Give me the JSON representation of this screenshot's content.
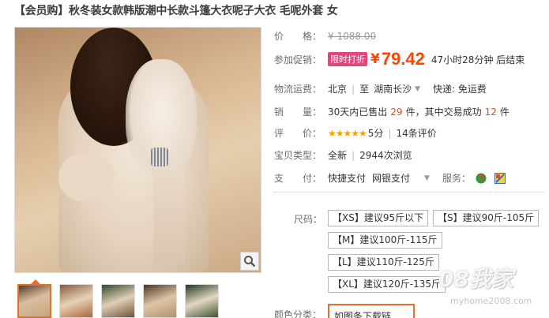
{
  "product": {
    "title": "【会员购】秋冬装女款韩版潮中长款斗篷大衣呢子大衣 毛呢外套 女"
  },
  "gallery": {
    "thumbnails": [
      "thumb-1",
      "thumb-2",
      "thumb-3",
      "thumb-4",
      "thumb-5"
    ],
    "zoom_icon": "magnifier-icon"
  },
  "props": {
    "price": {
      "label": "价　　格：",
      "value": "¥ 1088.00"
    },
    "promo": {
      "label": "参加促销：",
      "tag": "限时打折",
      "yen": "¥",
      "price": "79.42",
      "timer": "47小时28分钟 后结束"
    },
    "logistics": {
      "label": "物流运费：",
      "from": "北京",
      "to_prefix": "至",
      "to": "湖南长沙",
      "caret": "▼",
      "shipping": "快递: 免运费"
    },
    "sales": {
      "label": "销　　量：",
      "prefix": "30天内已售出",
      "sold": "29",
      "unit1": "件，其中交易成功",
      "success": "12",
      "unit2": "件"
    },
    "rating": {
      "label": "评　　价：",
      "stars": "★★★★★",
      "score": "5分",
      "reviews": "14条评价"
    },
    "type": {
      "label": "宝贝类型：",
      "condition": "全新",
      "views": "2944次浏览"
    },
    "payment": {
      "label": "支　　付：",
      "method1": "快捷支付",
      "method2": "网银支付",
      "caret": "▼",
      "service_label": "服务："
    }
  },
  "sizes": {
    "label": "尺码：",
    "options": [
      "【XS】建议95斤以下",
      "【S】建议90斤-105斤",
      "【M】建议100斤-115斤",
      "【L】建议110斤-125斤",
      "【XL】建议120斤-135斤"
    ]
  },
  "colors": {
    "label": "颜色分类：",
    "selected": "如图条下载链"
  },
  "watermark": {
    "main": "08我家",
    "sub": "myhome2008.com"
  }
}
